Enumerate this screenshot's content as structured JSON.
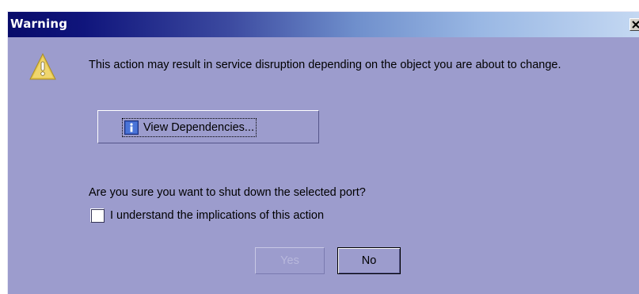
{
  "window": {
    "title": "Warning",
    "close_icon": "close-icon"
  },
  "content": {
    "icon": "warning-icon",
    "message": "This action may result in service disruption depending on the object you are about to change.",
    "view_dependencies": {
      "label": "View Dependencies...",
      "icon": "info-icon"
    },
    "question": "Are you sure you want to shut down the selected port?",
    "confirm_checkbox": {
      "label": "I understand the implications of this action",
      "checked": false
    }
  },
  "buttons": {
    "yes_label": "Yes",
    "yes_enabled": false,
    "no_label": "No"
  },
  "colors": {
    "dialog_background": "#9c9ccd",
    "titlebar_start": "#080b6a",
    "titlebar_end": "#c4d8f2",
    "warning_icon": "#e8c84a"
  }
}
